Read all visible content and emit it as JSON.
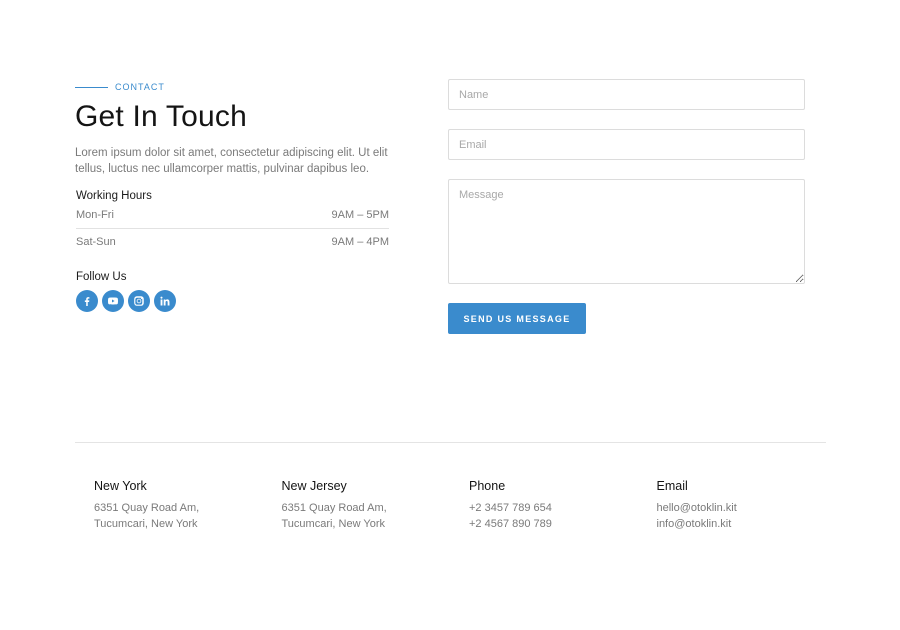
{
  "contact": {
    "eyebrow": "CONTACT",
    "title": "Get In Touch",
    "description": "Lorem ipsum dolor sit amet, consectetur adipiscing elit. Ut elit tellus, luctus nec ullamcorper mattis, pulvinar dapibus leo.",
    "working_hours": {
      "title": "Working Hours",
      "rows": [
        {
          "day": "Mon-Fri",
          "time": "9AM – 5PM"
        },
        {
          "day": "Sat-Sun",
          "time": "9AM – 4PM"
        }
      ]
    },
    "follow": {
      "title": "Follow Us",
      "icons": [
        "facebook-icon",
        "youtube-icon",
        "instagram-icon",
        "linkedin-icon"
      ]
    }
  },
  "form": {
    "name_placeholder": "Name",
    "email_placeholder": "Email",
    "message_placeholder": "Message",
    "submit_label": "SEND US MESSAGE"
  },
  "footer": {
    "columns": [
      {
        "title": "New York",
        "lines": [
          "6351 Quay Road Am,",
          "Tucumcari, New York"
        ]
      },
      {
        "title": "New Jersey",
        "lines": [
          "6351 Quay Road Am,",
          "Tucumcari, New York"
        ]
      },
      {
        "title": "Phone",
        "lines": [
          "+2 3457 789 654",
          "+2 4567 890 789"
        ]
      },
      {
        "title": "Email",
        "lines": [
          "hello@otoklin.kit",
          "info@otoklin.kit"
        ]
      }
    ]
  },
  "colors": {
    "accent": "#3a8bcd",
    "text_dark": "#141414",
    "text_muted": "#7a7a7a",
    "border": "#dcdcdc"
  }
}
